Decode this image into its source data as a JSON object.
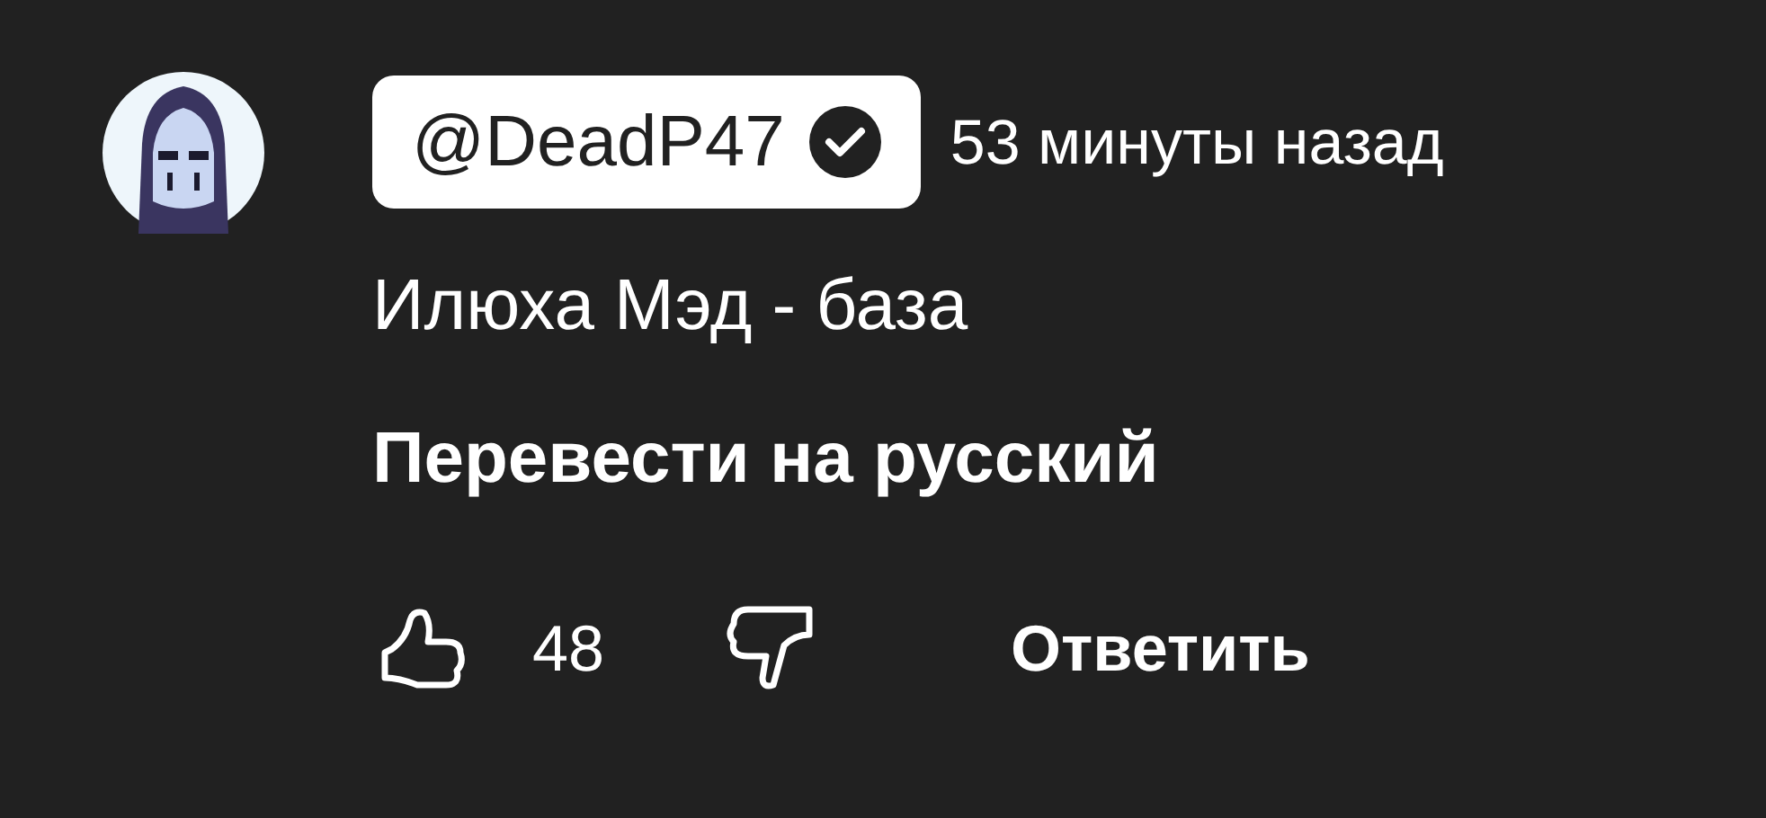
{
  "comment": {
    "author": "@DeadP47",
    "verified": true,
    "time": "53 минуты назад",
    "text": "Илюха Мэд - база",
    "translate": "Перевести на русский"
  },
  "actions": {
    "likes": "48",
    "reply": "Ответить"
  }
}
